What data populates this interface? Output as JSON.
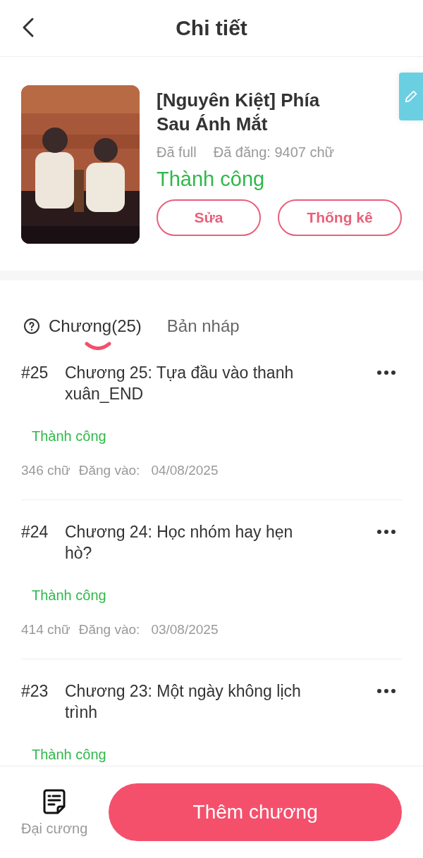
{
  "header": {
    "title": "Chi tiết"
  },
  "book": {
    "title": "[Nguyên Kiệt] Phía Sau Ánh Mắt",
    "progress": "Đã full",
    "posted": "Đã đăng: 9407 chữ",
    "status": {
      "text": "Thành công",
      "kind": "success"
    },
    "cover": {
      "kind": "picture"
    },
    "buttons": [
      "Sửa",
      "Thống kê"
    ]
  },
  "tabs": [
    {
      "label": "Chương(25)",
      "selected": true
    },
    {
      "label": "Bản nháp",
      "selected": false
    }
  ],
  "chapters": [
    {
      "number": "#25",
      "title": "Chương 25: Tựa đầu vào thanh xuân_END",
      "status": {
        "text": "Thành công",
        "kind": "success"
      },
      "words": "346 chữ",
      "posted_label": "Đăng vào:",
      "date": "04/08/2025"
    },
    {
      "number": "#24",
      "title": "Chương 24: Học nhóm hay hẹn hò?",
      "status": {
        "text": "Thành công",
        "kind": "success"
      },
      "words": "414 chữ",
      "posted_label": "Đăng vào:",
      "date": "03/08/2025"
    },
    {
      "number": "#23",
      "title": "Chương 23: Một ngày không lịch trình",
      "status": {
        "text": "Thành công",
        "kind": "success"
      }
    }
  ],
  "bottom_bar": {
    "outline_label": "Đại cương",
    "add_button": "Thêm chương"
  }
}
